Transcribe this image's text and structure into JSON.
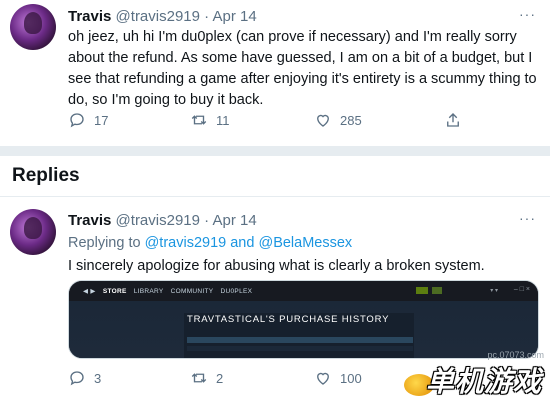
{
  "tweet1": {
    "author": "Travis",
    "handle": "@travis2919",
    "date": "· Apr 14",
    "more": "···",
    "text": "oh jeez, uh hi I'm du0plex (can prove if necessary) and I'm really sorry about the refund. As some have guessed, I am on a bit of a budget, but I see that refunding a game after enjoying it's entirety is a scummy thing to do, so I'm going to buy it back.",
    "replies": "17",
    "retweets": "11",
    "likes": "285"
  },
  "replies_section": {
    "title": "Replies"
  },
  "tweet2": {
    "author": "Travis",
    "handle": "@travis2919",
    "date": "· Apr 14",
    "more": "···",
    "replying_prefix": "Replying to",
    "replying_user1": "@travis2919",
    "replying_and": "and",
    "replying_user2": "@BelaMessex",
    "text": "I sincerely apologize for abusing what is clearly a broken system.",
    "replies": "3",
    "retweets": "2",
    "likes": "100",
    "attachment": {
      "nav": [
        "STORE",
        "LIBRARY",
        "COMMUNITY",
        "DU0PLEX"
      ],
      "page_title": "TRAVTASTICAL'S PURCHASE HISTORY"
    }
  },
  "watermark": {
    "url": "pc.07073.com",
    "text": "单机游戏"
  },
  "colors": {
    "link": "#1b95e0",
    "secondary": "#5b7083",
    "divider": "#e6ecf0",
    "steam_bg": "#1b2838"
  }
}
